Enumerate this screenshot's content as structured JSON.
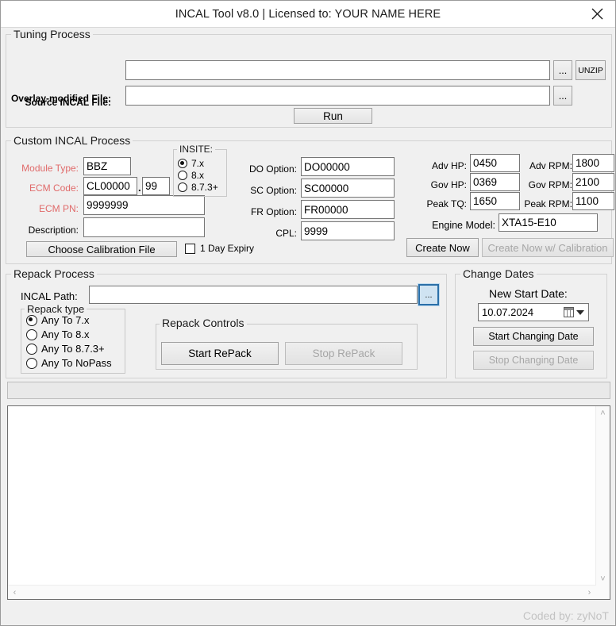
{
  "window": {
    "title": "INCAL Tool v8.0 | Licensed to: YOUR NAME HERE",
    "close_icon": "close-icon"
  },
  "tuning_process": {
    "legend": "Tuning Process",
    "source_label": "Source INCAL File:",
    "source_value": "",
    "source_browse": "...",
    "unzip_label": "UNZIP",
    "overlay_label": "Overlay-modified File:",
    "overlay_value": "",
    "overlay_browse": "...",
    "run_label": "Run"
  },
  "custom_incal": {
    "legend": "Custom INCAL Process",
    "module_type_label": "Module Type:",
    "module_type_value": "BBZ",
    "ecm_code_label": "ECM Code:",
    "ecm_code_value": "CL00000",
    "ecm_code_separator": ".",
    "ecm_code_suffix_value": "99",
    "ecm_pn_label": "ECM PN:",
    "ecm_pn_value": "9999999",
    "description_label": "Description:",
    "description_value": "",
    "choose_calibration_label": "Choose Calibration File",
    "expiry_checkbox_label": "1 Day Expiry",
    "expiry_checked": false,
    "insite": {
      "legend": "INSITE:",
      "options": [
        {
          "label": "7.x",
          "selected": true
        },
        {
          "label": "8.x",
          "selected": false
        },
        {
          "label": "8.7.3+",
          "selected": false
        }
      ]
    },
    "do_option_label": "DO Option:",
    "do_option_value": "DO00000",
    "sc_option_label": "SC Option:",
    "sc_option_value": "SC00000",
    "fr_option_label": "FR Option:",
    "fr_option_value": "FR00000",
    "cpl_label": "CPL:",
    "cpl_value": "9999",
    "adv_hp_label": "Adv HP:",
    "adv_hp_value": "0450",
    "adv_rpm_label": "Adv RPM:",
    "adv_rpm_value": "1800",
    "gov_hp_label": "Gov HP:",
    "gov_hp_value": "0369",
    "gov_rpm_label": "Gov RPM:",
    "gov_rpm_value": "2100",
    "peak_tq_label": "Peak TQ:",
    "peak_tq_value": "1650",
    "peak_rpm_label": "Peak RPM:",
    "peak_rpm_value": "1100",
    "engine_model_label": "Engine Model:",
    "engine_model_value": "XTA15-E10",
    "create_now_label": "Create Now",
    "create_now_cal_label": "Create Now w/ Calibration"
  },
  "repack_process": {
    "legend": "Repack Process",
    "incal_path_label": "INCAL Path:",
    "incal_path_value": "",
    "incal_path_browse": "...",
    "repack_type": {
      "legend": "Repack type",
      "options": [
        {
          "label": "Any To 7.x",
          "selected": true
        },
        {
          "label": "Any To 8.x",
          "selected": false
        },
        {
          "label": "Any To 8.7.3+",
          "selected": false
        },
        {
          "label": "Any To NoPass",
          "selected": false
        }
      ]
    },
    "repack_controls": {
      "legend": "Repack Controls",
      "start_label": "Start RePack",
      "stop_label": "Stop RePack",
      "stop_enabled": false
    }
  },
  "change_dates": {
    "legend": "Change Dates",
    "new_start_date_label": "New Start Date:",
    "new_start_date_value": "10.07.2024",
    "calendar_icon": "calendar-icon",
    "dropdown_icon": "chevron-down-icon",
    "start_label": "Start Changing Date",
    "stop_label": "Stop Changing Date",
    "stop_enabled": false
  },
  "progress": {
    "value": 0
  },
  "output": {
    "text": "",
    "scroll_up_icon": "˄",
    "scroll_down_icon": "˅",
    "scroll_left_icon": "‹",
    "scroll_right_icon": "›"
  },
  "footer": {
    "credit": "Coded by: zyNoT"
  },
  "colors": {
    "window_bg": "#f0f0f0",
    "titlebar_bg": "#ffffff",
    "label_red": "#e06a6a",
    "focus_blue": "#2a6fa8",
    "credit_gray": "#c3c3c3"
  }
}
